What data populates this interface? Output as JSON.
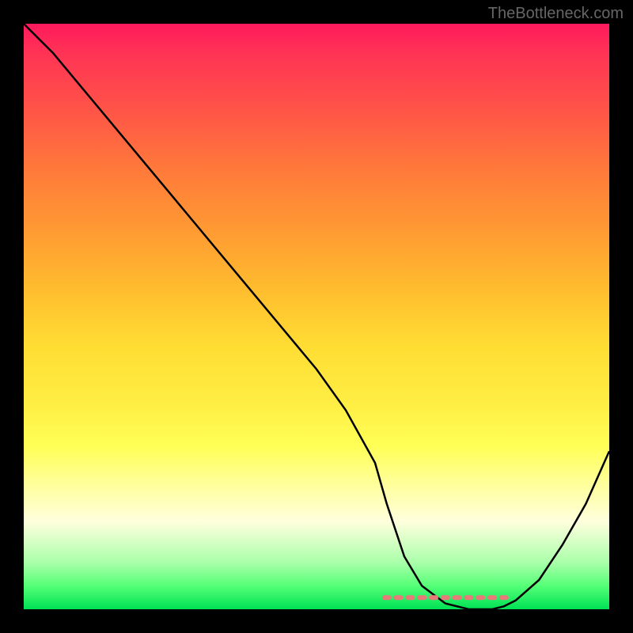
{
  "watermark": "TheBottleneck.com",
  "chart_data": {
    "type": "line",
    "title": "",
    "xlabel": "",
    "ylabel": "",
    "xlim": [
      0,
      100
    ],
    "ylim": [
      0,
      100
    ],
    "series": [
      {
        "name": "bottleneck-curve",
        "x": [
          0,
          5,
          10,
          15,
          20,
          25,
          30,
          35,
          40,
          45,
          50,
          55,
          60,
          62,
          65,
          68,
          72,
          76,
          80,
          82,
          84,
          88,
          92,
          96,
          100
        ],
        "y": [
          100,
          95,
          89,
          83,
          77,
          71,
          65,
          59,
          53,
          47,
          41,
          34,
          25,
          18,
          9,
          4,
          1,
          0,
          0,
          0.5,
          1.5,
          5,
          11,
          18,
          27
        ]
      }
    ],
    "markers": {
      "name": "highlight-dashes",
      "x": [
        62,
        64,
        66,
        68,
        70,
        72,
        74,
        76,
        78,
        80,
        82
      ],
      "y": [
        2,
        2,
        2,
        2,
        2,
        2,
        2,
        2,
        2,
        2,
        2
      ]
    },
    "gradient_colors": {
      "top": "#ff1a5c",
      "middle": "#ffdd33",
      "bottom": "#00e255"
    }
  }
}
